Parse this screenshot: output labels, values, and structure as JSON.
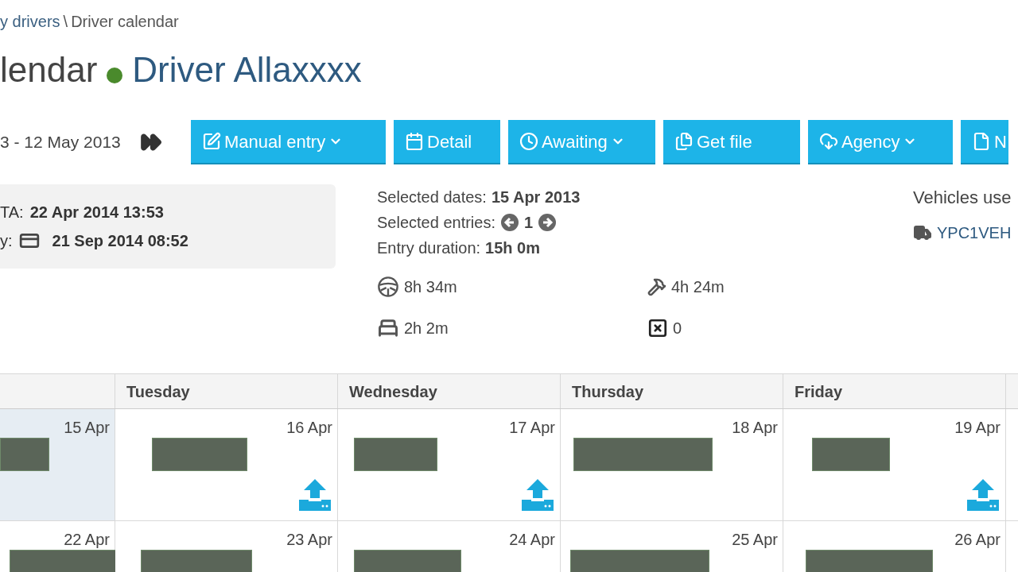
{
  "breadcrumb": {
    "link": "y drivers",
    "separator": "\\",
    "current": "Driver calendar"
  },
  "title": {
    "prefix": "lendar",
    "color": "#4a8a2c",
    "driver": "Driver Allaxxxx"
  },
  "toolbar": {
    "date_range": "3 - 12 May 2013",
    "buttons": [
      {
        "kind": "edit",
        "label": "Manual entry",
        "dropdown": true
      },
      {
        "kind": "calendar",
        "label": "Detail",
        "dropdown": false
      },
      {
        "kind": "clock",
        "label": "Awaiting",
        "dropdown": true
      },
      {
        "kind": "files",
        "label": "Get file",
        "dropdown": false
      },
      {
        "kind": "cloud",
        "label": "Agency",
        "dropdown": true
      },
      {
        "kind": "file",
        "label": "N",
        "dropdown": false
      }
    ]
  },
  "card_info": {
    "lines": [
      {
        "label": "TA:",
        "value": "22 Apr 2014 13:53",
        "card_icon": false
      },
      {
        "label": "y:",
        "value": "21 Sep 2014 08:52",
        "card_icon": true
      }
    ]
  },
  "selection": {
    "dates_label": "Selected dates:",
    "dates_value": "15 Apr 2013",
    "entries_label": "Selected entries:",
    "entries_value": "1",
    "duration_label": "Entry duration:",
    "duration_value": "15h 0m"
  },
  "totals": [
    {
      "kind": "driving",
      "value": "8h 34m"
    },
    {
      "kind": "work",
      "value": "4h 24m"
    },
    {
      "kind": "rest",
      "value": "2h 2m"
    },
    {
      "kind": "infringements",
      "value": "0"
    }
  ],
  "vehicles": {
    "heading": "Vehicles use",
    "items": [
      "YPC1VEH"
    ]
  },
  "calendar": {
    "columns": [
      "",
      "Tuesday",
      "Wednesday",
      "Thursday",
      "Friday"
    ],
    "weeks": [
      {
        "days": [
          {
            "date": "15 Apr",
            "selected": true,
            "upload": false
          },
          {
            "date": "16 Apr",
            "selected": false,
            "upload": true
          },
          {
            "date": "17 Apr",
            "selected": false,
            "upload": true
          },
          {
            "date": "18 Apr",
            "selected": false,
            "upload": false
          },
          {
            "date": "19 Apr",
            "selected": false,
            "upload": true
          }
        ]
      },
      {
        "days": [
          {
            "date": "22 Apr",
            "selected": false,
            "upload": false
          },
          {
            "date": "23 Apr",
            "selected": false,
            "upload": false
          },
          {
            "date": "24 Apr",
            "selected": false,
            "upload": false
          },
          {
            "date": "25 Apr",
            "selected": false,
            "upload": false
          },
          {
            "date": "26 Apr",
            "selected": false,
            "upload": false
          }
        ]
      }
    ]
  }
}
